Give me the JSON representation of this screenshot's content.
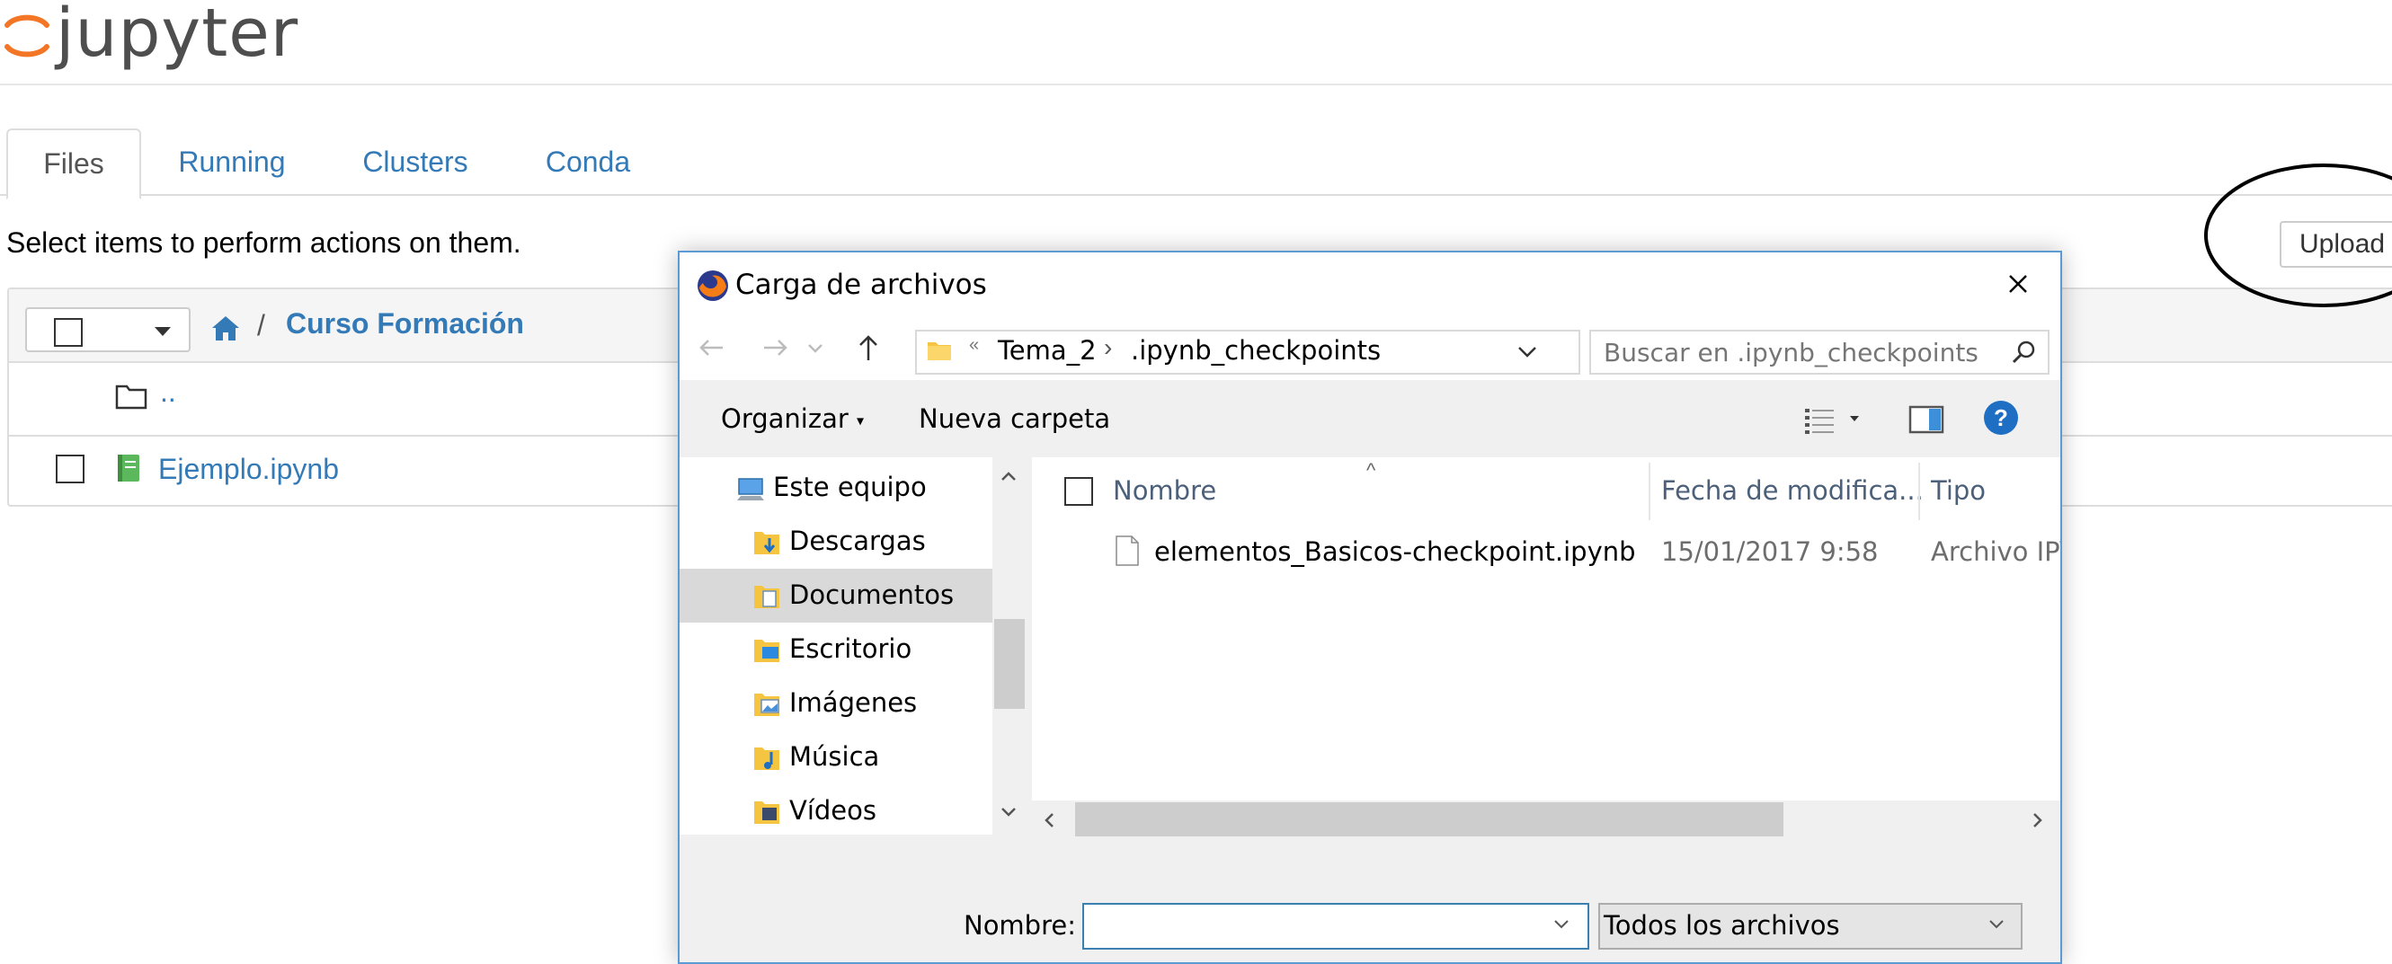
{
  "app": {
    "logo_text": "jupyter"
  },
  "tabs": [
    {
      "label": "Files"
    },
    {
      "label": "Running"
    },
    {
      "label": "Clusters"
    },
    {
      "label": "Conda"
    }
  ],
  "files_view": {
    "select_message": "Select items to perform actions on them.",
    "breadcrumb_separator": "/",
    "current_folder": "Curso Formación",
    "parent_link": "..",
    "items": [
      {
        "name": "Ejemplo.ipynb"
      }
    ],
    "upload_label": "Upload"
  },
  "dialog": {
    "title": "Carga de archivos",
    "address": {
      "overflow": "«",
      "segments": [
        "Tema_2",
        ".ipynb_checkpoints"
      ]
    },
    "search_placeholder": "Buscar en .ipynb_checkpoints",
    "toolbar": {
      "organize": "Organizar",
      "new_folder": "Nueva carpeta"
    },
    "tree": [
      {
        "label": "Este equipo",
        "icon": "computer-icon"
      },
      {
        "label": "Descargas",
        "icon": "downloads-folder-icon"
      },
      {
        "label": "Documentos",
        "icon": "documents-folder-icon",
        "selected": true
      },
      {
        "label": "Escritorio",
        "icon": "desktop-folder-icon"
      },
      {
        "label": "Imágenes",
        "icon": "pictures-folder-icon"
      },
      {
        "label": "Música",
        "icon": "music-folder-icon"
      },
      {
        "label": "Vídeos",
        "icon": "videos-folder-icon"
      }
    ],
    "columns": {
      "name": "Nombre",
      "date": "Fecha de modifica...",
      "type": "Tipo"
    },
    "files": [
      {
        "name": "elementos_Basicos-checkpoint.ipynb",
        "date": "15/01/2017 9:58",
        "type": "Archivo IPYNB"
      }
    ],
    "filename_label": "Nombre:",
    "filename_value": "",
    "filetype_value": "Todos los archivos"
  },
  "colors": {
    "link": "#337ab7",
    "jupyter_orange": "#f37626",
    "dialog_border": "#5b9bd5",
    "help_blue": "#1e6fc3"
  }
}
